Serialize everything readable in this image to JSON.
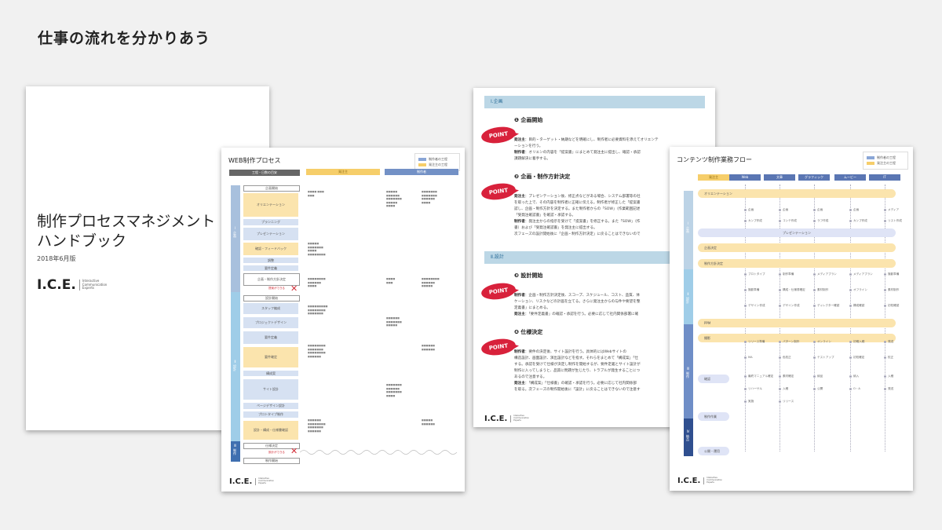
{
  "slide": {
    "title": "仕事の流れを分かりあう"
  },
  "cover": {
    "title_line1": "制作プロセスマネジメント",
    "title_line2": "ハンドブック",
    "date": "2018年6月版",
    "logo": "I.C.E.",
    "logo_sub": [
      "Interactive",
      "Communication",
      "Experts"
    ]
  },
  "web_process": {
    "title": "WEB制作プロセス",
    "legend": [
      "制作者の工程",
      "発注主の工程"
    ],
    "col_headers": [
      "工程・日数の目安",
      "発注主",
      "制作者"
    ],
    "steps": [
      "企画開始",
      "オリエンテーション",
      "プランニング",
      "プレゼンテーション",
      "確認・フィードバック",
      "調整",
      "要件定義",
      "企画・制作方針決定",
      "設計開始",
      "スタッフ編成",
      "プロジェクトデザイン",
      "要件定義",
      "要件確定",
      "構成案",
      "サイト設計",
      "ページデザイン設計",
      "プロトタイプ制作",
      "設計・構成・仕様書確認",
      "仕様決定",
      "制作開始"
    ],
    "red_labels": [
      "提案ができる",
      "設計ができる"
    ],
    "phases": [
      "Ⅰ 企画",
      "Ⅱ 設計",
      "Ⅲ 制作"
    ]
  },
  "points": {
    "section1": "Ⅰ.企画",
    "section2": "Ⅱ.設計",
    "items": [
      {
        "title": "❶ 企画開始",
        "lines": [
          {
            "who": "発注主",
            "text": "：目的・ターゲット・納期などを明確にし、制作者に必要資料を添えてオリエンテ"
          },
          {
            "who": "",
            "text": "ーションを行う。"
          },
          {
            "who": "制作者",
            "text": "：オリエンの内容を「提案書」にまとめて発注主に提出し、確認・承認"
          },
          {
            "who": "",
            "text": "課題解決に着手する。"
          }
        ]
      },
      {
        "title": "❷ 企画・制作方針決定",
        "lines": [
          {
            "who": "発注主",
            "text": "：プレゼンテーション後、修正点などがある場合、システム部署等の社"
          },
          {
            "who": "",
            "text": "を取った上で、その内容を制作者に正確に伝える。制作者が修正した「提案書"
          },
          {
            "who": "",
            "text": "認し、企画・制作方針を決定する。また制作者からの「SOW」（作業範囲記述"
          },
          {
            "who": "",
            "text": "「受発注確認書」を確認・承認する。"
          },
          {
            "who": "制作者",
            "text": "：発注主からの指示を受けて「提案書」を修正する。また「SOW」（作"
          },
          {
            "who": "",
            "text": "書）および「受発注確認書」を発注主に提出する。"
          },
          {
            "who": "",
            "text": "次フェーズの設計開始後に「企画・制作方針決定」に戻ることはできないので"
          }
        ]
      },
      {
        "title": "❸ 設計開始",
        "lines": [
          {
            "who": "制作者",
            "text": "：企画・制作方針決定後、スコープ、スケジュール、コスト、品質、体"
          },
          {
            "who": "",
            "text": "ケーション、リスクなどの計画を立てる。さらに発注主からの与件や要望を整"
          },
          {
            "who": "",
            "text": "定義書」にまとめる。"
          },
          {
            "who": "発注主",
            "text": "：「要件定義書」の確認・承認を行う。必要に応じて社内関係部署に確"
          }
        ]
      },
      {
        "title": "❹ 仕様決定",
        "lines": [
          {
            "who": "制作者",
            "text": "：要件の決定後、サイト設計を行う。具体的にはWebサイトの"
          },
          {
            "who": "",
            "text": "構造設計、画面設計、演出設計などを指す。それらをまとめて「構成案」「仕"
          },
          {
            "who": "",
            "text": "する。承認を受けて仕様が決定し制作を開始するが、要件定義とサイト設計が"
          },
          {
            "who": "",
            "text": "制作に入ってしまうと、品質に問題が生じたり、トラブルが発生することにつ"
          },
          {
            "who": "",
            "text": "あるので注意する。"
          },
          {
            "who": "発注主",
            "text": "：「構成案」「仕様書」の確認・承認を行う。必要に応じて社内関係部"
          },
          {
            "who": "",
            "text": "を取る。次フェーズの制作開始後に「設計」に戻ることはできないので注意す"
          }
        ]
      }
    ],
    "point_label": "POINT",
    "logo": "I.C.E."
  },
  "contents_flow": {
    "title": "コンテンツ制作業務フロー",
    "legend": [
      "制作者の工程",
      "発注主の工程"
    ],
    "col_headers": [
      "発注主",
      "Web",
      "文章",
      "グラフィック",
      "ムービー",
      "IT"
    ],
    "rows": [
      "オリエンテーション",
      "プレゼンテーション",
      "企画決定",
      "制作方針決定",
      "PPM",
      "撮影",
      "確認",
      "制作作業",
      "公開・運用"
    ],
    "labels": [
      "企画",
      "企画",
      "企画",
      "企画",
      "メディア",
      "カンプ作成",
      "コンテ作成",
      "ラフ作成",
      "カンプ作成",
      "リスト作成",
      "プロトタイプ",
      "制作準備",
      "メディアプラン",
      "メディアプラン",
      "撮影準備",
      "撮影準備",
      "構成・仕様書確定",
      "素材制作",
      "オフライン",
      "素材制作",
      "デザイン作成",
      "デザイン作成",
      "ディレクター確認",
      "構成確認",
      "初校確認",
      "リリース準備",
      "パターン制作",
      "オンライン",
      "初稿入稿",
      "発送",
      "MA",
      "色校正",
      "テストアップ",
      "初校確定",
      "校正",
      "最終マニュアル確定",
      "素材確定",
      "納品",
      "納入",
      "入稿",
      "リハーサル",
      "入稿",
      "公開",
      "O・A",
      "発送",
      "実施",
      "リリース"
    ],
    "phases": [
      "Ⅰ 企画",
      "Ⅱ 設計",
      "Ⅲ 制作",
      "Ⅳ 納品"
    ],
    "logo": "I.C.E."
  },
  "colors": {
    "accent_red": "#d8213b",
    "process_blue": "#8aa6d6",
    "client_yellow": "#f6ce6a",
    "section_bar": "#bcd7e6"
  }
}
